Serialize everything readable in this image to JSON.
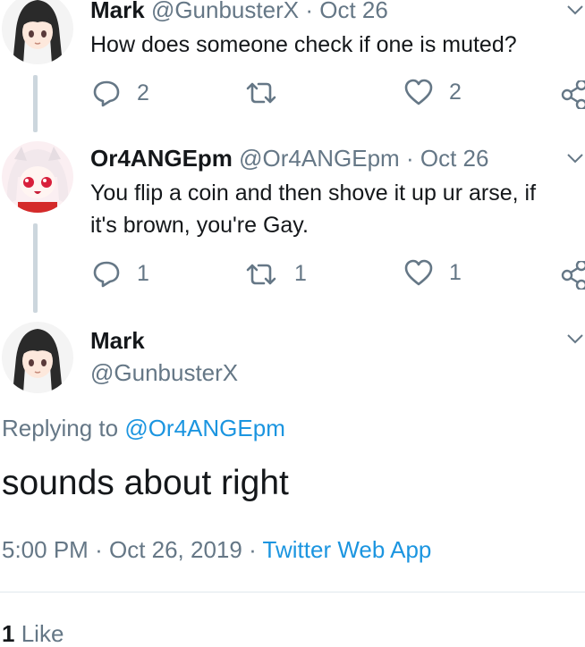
{
  "tweet1": {
    "name": "Mark",
    "handle": "@GunbusterX",
    "sep": "·",
    "date": "Oct 26",
    "text": "How does someone check if one is muted?",
    "replies": "2",
    "retweets": "",
    "likes": "2"
  },
  "tweet2": {
    "name": "Or4ANGEpm",
    "handle": "@Or4ANGEpm",
    "sep": "·",
    "date": "Oct 26",
    "text_line1": "You flip a coin and then shove it up ur arse, if",
    "text_line2": "it's brown, you're Gay.",
    "replies": "1",
    "retweets": "1",
    "likes": "1"
  },
  "main": {
    "name": "Mark",
    "handle": "@GunbusterX",
    "replying_prefix": "Replying to",
    "replying_handle": "@Or4ANGEpm",
    "text": "sounds about right",
    "time": "5:00 PM",
    "sep": "·",
    "date": "Oct 26, 2019",
    "sep2": "·",
    "source": "Twitter Web App",
    "like_count": "1",
    "like_label": "Like"
  },
  "icons": {
    "reply": "reply-icon",
    "retweet": "retweet-icon",
    "like": "heart-icon",
    "share": "share-icon",
    "more": "chevron-down-icon"
  },
  "colors": {
    "text": "#14171a",
    "muted": "#657786",
    "link": "#1b95e0",
    "thread_line": "#ccd6dd"
  }
}
